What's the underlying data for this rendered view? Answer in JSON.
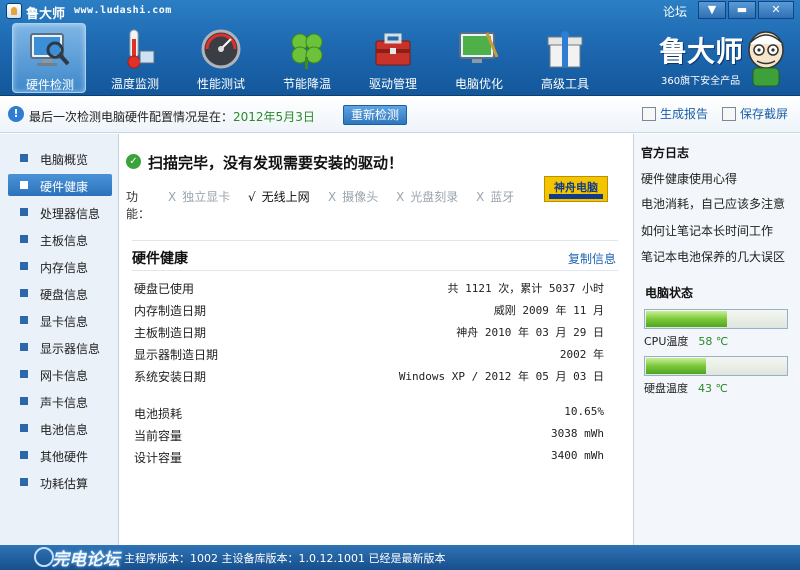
{
  "app": {
    "name": "鲁大师",
    "site": "www.ludashi.com",
    "forum": "论坛",
    "menu_glyph": "▼",
    "minimize_glyph": "▬",
    "close_glyph": "✕"
  },
  "toolbar": {
    "tools": [
      {
        "label": "硬件检测",
        "icon": "monitor-magnifier-icon",
        "active": true
      },
      {
        "label": "温度监测",
        "icon": "thermometer-icon",
        "active": false
      },
      {
        "label": "性能测试",
        "icon": "speedometer-icon",
        "active": false
      },
      {
        "label": "节能降温",
        "icon": "clover-icon",
        "active": false
      },
      {
        "label": "驱动管理",
        "icon": "toolbox-icon",
        "active": false
      },
      {
        "label": "电脑优化",
        "icon": "monitor-broom-icon",
        "active": false
      },
      {
        "label": "高级工具",
        "icon": "gift-box-icon",
        "active": false
      }
    ]
  },
  "brand": {
    "name": "鲁大师",
    "slogan": "360旗下安全产品"
  },
  "infobar": {
    "text": "最后一次检测电脑硬件配置情况是在：",
    "date": "2012年5月3日",
    "recheck": "重新检测",
    "report": "生成报告",
    "screenshot": "保存截屏"
  },
  "sidebar": {
    "items": [
      {
        "label": "电脑概览",
        "active": false
      },
      {
        "label": "硬件健康",
        "active": true
      },
      {
        "label": "处理器信息",
        "active": false
      },
      {
        "label": "主板信息",
        "active": false
      },
      {
        "label": "内存信息",
        "active": false
      },
      {
        "label": "硬盘信息",
        "active": false
      },
      {
        "label": "显卡信息",
        "active": false
      },
      {
        "label": "显示器信息",
        "active": false
      },
      {
        "label": "网卡信息",
        "active": false
      },
      {
        "label": "声卡信息",
        "active": false
      },
      {
        "label": "电池信息",
        "active": false
      },
      {
        "label": "其他硬件",
        "active": false
      },
      {
        "label": "功耗估算",
        "active": false
      }
    ]
  },
  "main": {
    "scan_title": "扫描完毕，没有发现需要安装的驱动！",
    "feature_label": "功能：",
    "features": [
      {
        "mark": "X",
        "label": "独立显卡",
        "enabled": false
      },
      {
        "mark": "√",
        "label": "无线上网",
        "enabled": true
      },
      {
        "mark": "X",
        "label": "摄像头",
        "enabled": false
      },
      {
        "mark": "X",
        "label": "光盘刻录",
        "enabled": false
      },
      {
        "mark": "X",
        "label": "蓝牙",
        "enabled": false
      }
    ],
    "vendor_logo": "神舟电脑",
    "health_title": "硬件健康",
    "copy_info": "复制信息",
    "rows": [
      {
        "key": "硬盘已使用",
        "value": "共 1121 次，累计 5037 小时"
      },
      {
        "key": "内存制造日期",
        "value": "威刚 2009 年 11 月"
      },
      {
        "key": "主板制造日期",
        "value": "神舟 2010 年 03 月 29 日"
      },
      {
        "key": "显示器制造日期",
        "value": "2002 年"
      },
      {
        "key": "系统安装日期",
        "value": "Windows XP / 2012 年 05 月 03 日"
      }
    ],
    "battery_rows": [
      {
        "key": "电池损耗",
        "value": "10.65%"
      },
      {
        "key": "当前容量",
        "value": "3038 mWh"
      },
      {
        "key": "设计容量",
        "value": "3400 mWh"
      }
    ]
  },
  "right": {
    "blog_title": "官方日志",
    "blog_links": [
      "硬件健康使用心得",
      "电池消耗，自己应该多注意",
      "如何让笔记本长时间工作",
      "笔记本电池保养的几大误区"
    ],
    "status_title": "电脑状态",
    "meters": [
      {
        "label": "CPU温度",
        "value": "58 ℃",
        "level": 0.58
      },
      {
        "label": "硬盘温度",
        "value": "43 ℃",
        "level": 0.43
      }
    ]
  },
  "footer": {
    "watermark": "完电论坛",
    "text": "主程序版本：1002   主设备库版本：1.0.12.1001   已经是最新版本"
  }
}
